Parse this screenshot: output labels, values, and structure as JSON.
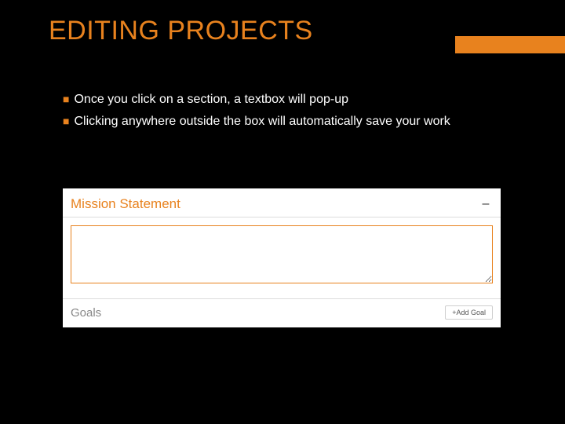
{
  "title": "EDITING PROJECTS",
  "bullets": [
    "Once you click on a section, a textbox will pop-up",
    "Clicking anywhere outside the box will automatically save your work"
  ],
  "form": {
    "mission_label": "Mission Statement",
    "collapse_glyph": "–",
    "textarea_value": "",
    "goals_label": "Goals",
    "add_goal_label": "+Add Goal"
  }
}
